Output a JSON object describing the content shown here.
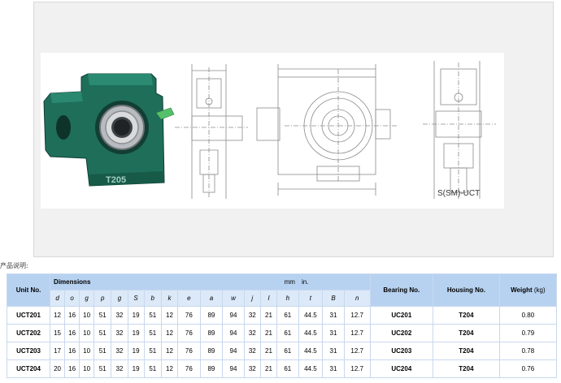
{
  "figure": {
    "housing_casting": "T205",
    "diagram_label": "S(SM)-UCT"
  },
  "section_label": "产品说明:",
  "table": {
    "unit_header": "Unit No.",
    "dimensions_header": "Dimensions",
    "units_mm": "mm",
    "units_in": "in.",
    "bearing_header": "Bearing No.",
    "housing_header": "Housing No.",
    "weight_header": "Weight",
    "weight_unit": "(kg)",
    "dims": [
      "d",
      "o",
      "g",
      "p",
      "g",
      "S",
      "b",
      "k",
      "e",
      "a",
      "w",
      "j",
      "l",
      "h",
      "t",
      "B",
      "n"
    ],
    "rows": [
      {
        "unit": "UCT201",
        "values": [
          "12",
          "16",
          "10",
          "51",
          "32",
          "19",
          "51",
          "12",
          "76",
          "89",
          "94",
          "32",
          "21",
          "61",
          "44.5",
          "31",
          "12.7"
        ],
        "bearing": "UC201",
        "housing": "T204",
        "weight": "0.80"
      },
      {
        "unit": "UCT202",
        "values": [
          "15",
          "16",
          "10",
          "51",
          "32",
          "19",
          "51",
          "12",
          "76",
          "89",
          "94",
          "32",
          "21",
          "61",
          "44.5",
          "31",
          "12.7"
        ],
        "bearing": "UC202",
        "housing": "T204",
        "weight": "0.79"
      },
      {
        "unit": "UCT203",
        "values": [
          "17",
          "16",
          "10",
          "51",
          "32",
          "19",
          "51",
          "12",
          "76",
          "89",
          "94",
          "32",
          "21",
          "61",
          "44.5",
          "31",
          "12.7"
        ],
        "bearing": "UC203",
        "housing": "T204",
        "weight": "0.78"
      },
      {
        "unit": "UCT204",
        "values": [
          "20",
          "16",
          "10",
          "51",
          "32",
          "19",
          "51",
          "12",
          "76",
          "89",
          "94",
          "32",
          "21",
          "61",
          "44.5",
          "31",
          "12.7"
        ],
        "bearing": "UC204",
        "housing": "T204",
        "weight": "0.76"
      }
    ]
  }
}
